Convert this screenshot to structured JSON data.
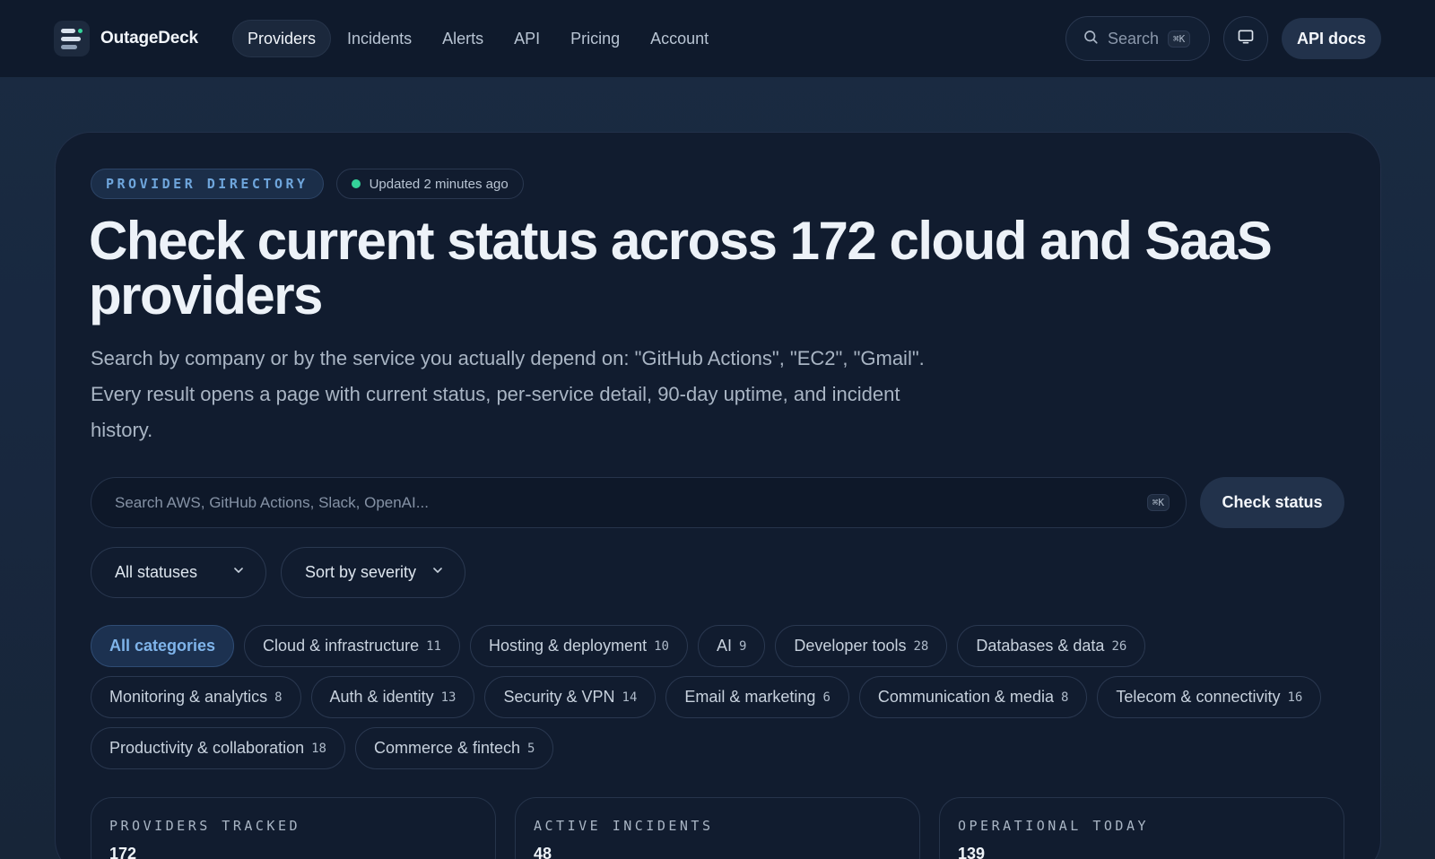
{
  "brand": {
    "name": "OutageDeck",
    "logo_icon": "stacked-bars-logo"
  },
  "nav": {
    "items": [
      {
        "label": "Providers",
        "active": true
      },
      {
        "label": "Incidents",
        "active": false
      },
      {
        "label": "Alerts",
        "active": false
      },
      {
        "label": "API",
        "active": false
      },
      {
        "label": "Pricing",
        "active": false
      },
      {
        "label": "Account",
        "active": false
      }
    ],
    "search_label": "Search",
    "search_shortcut": "⌘K",
    "display_icon": "monitor-icon",
    "api_docs_label": "API docs"
  },
  "hero": {
    "badge": "PROVIDER DIRECTORY",
    "updated": "Updated 2 minutes ago",
    "title": "Check current status across 172 cloud and SaaS providers",
    "lede": "Search by company or by the service you actually depend on: \"GitHub Actions\", \"EC2\", \"Gmail\". Every result opens a page with current status, per-service detail, 90-day uptime, and incident history."
  },
  "search": {
    "placeholder": "Search AWS, GitHub Actions, Slack, OpenAI...",
    "shortcut": "⌘K",
    "button": "Check status"
  },
  "filters": {
    "status": "All statuses",
    "sort": "Sort by severity"
  },
  "categories": [
    {
      "label": "All categories",
      "count": "",
      "active": true
    },
    {
      "label": "Cloud & infrastructure",
      "count": "11"
    },
    {
      "label": "Hosting & deployment",
      "count": "10"
    },
    {
      "label": "AI",
      "count": "9"
    },
    {
      "label": "Developer tools",
      "count": "28"
    },
    {
      "label": "Databases & data",
      "count": "26"
    },
    {
      "label": "Monitoring & analytics",
      "count": "8"
    },
    {
      "label": "Auth & identity",
      "count": "13"
    },
    {
      "label": "Security & VPN",
      "count": "14"
    },
    {
      "label": "Email & marketing",
      "count": "6"
    },
    {
      "label": "Communication & media",
      "count": "8"
    },
    {
      "label": "Telecom & connectivity",
      "count": "16"
    },
    {
      "label": "Productivity & collaboration",
      "count": "18"
    },
    {
      "label": "Commerce & fintech",
      "count": "5"
    }
  ],
  "stats": [
    {
      "label": "PROVIDERS TRACKED",
      "value": "172"
    },
    {
      "label": "ACTIVE INCIDENTS",
      "value": "48"
    },
    {
      "label": "OPERATIONAL TODAY",
      "value": "139"
    }
  ],
  "colors": {
    "accent_green": "#34d399",
    "accent_blue": "#7fb4ea",
    "nav_bg": "#0f1a2c",
    "card_bg": "#111c2f"
  }
}
